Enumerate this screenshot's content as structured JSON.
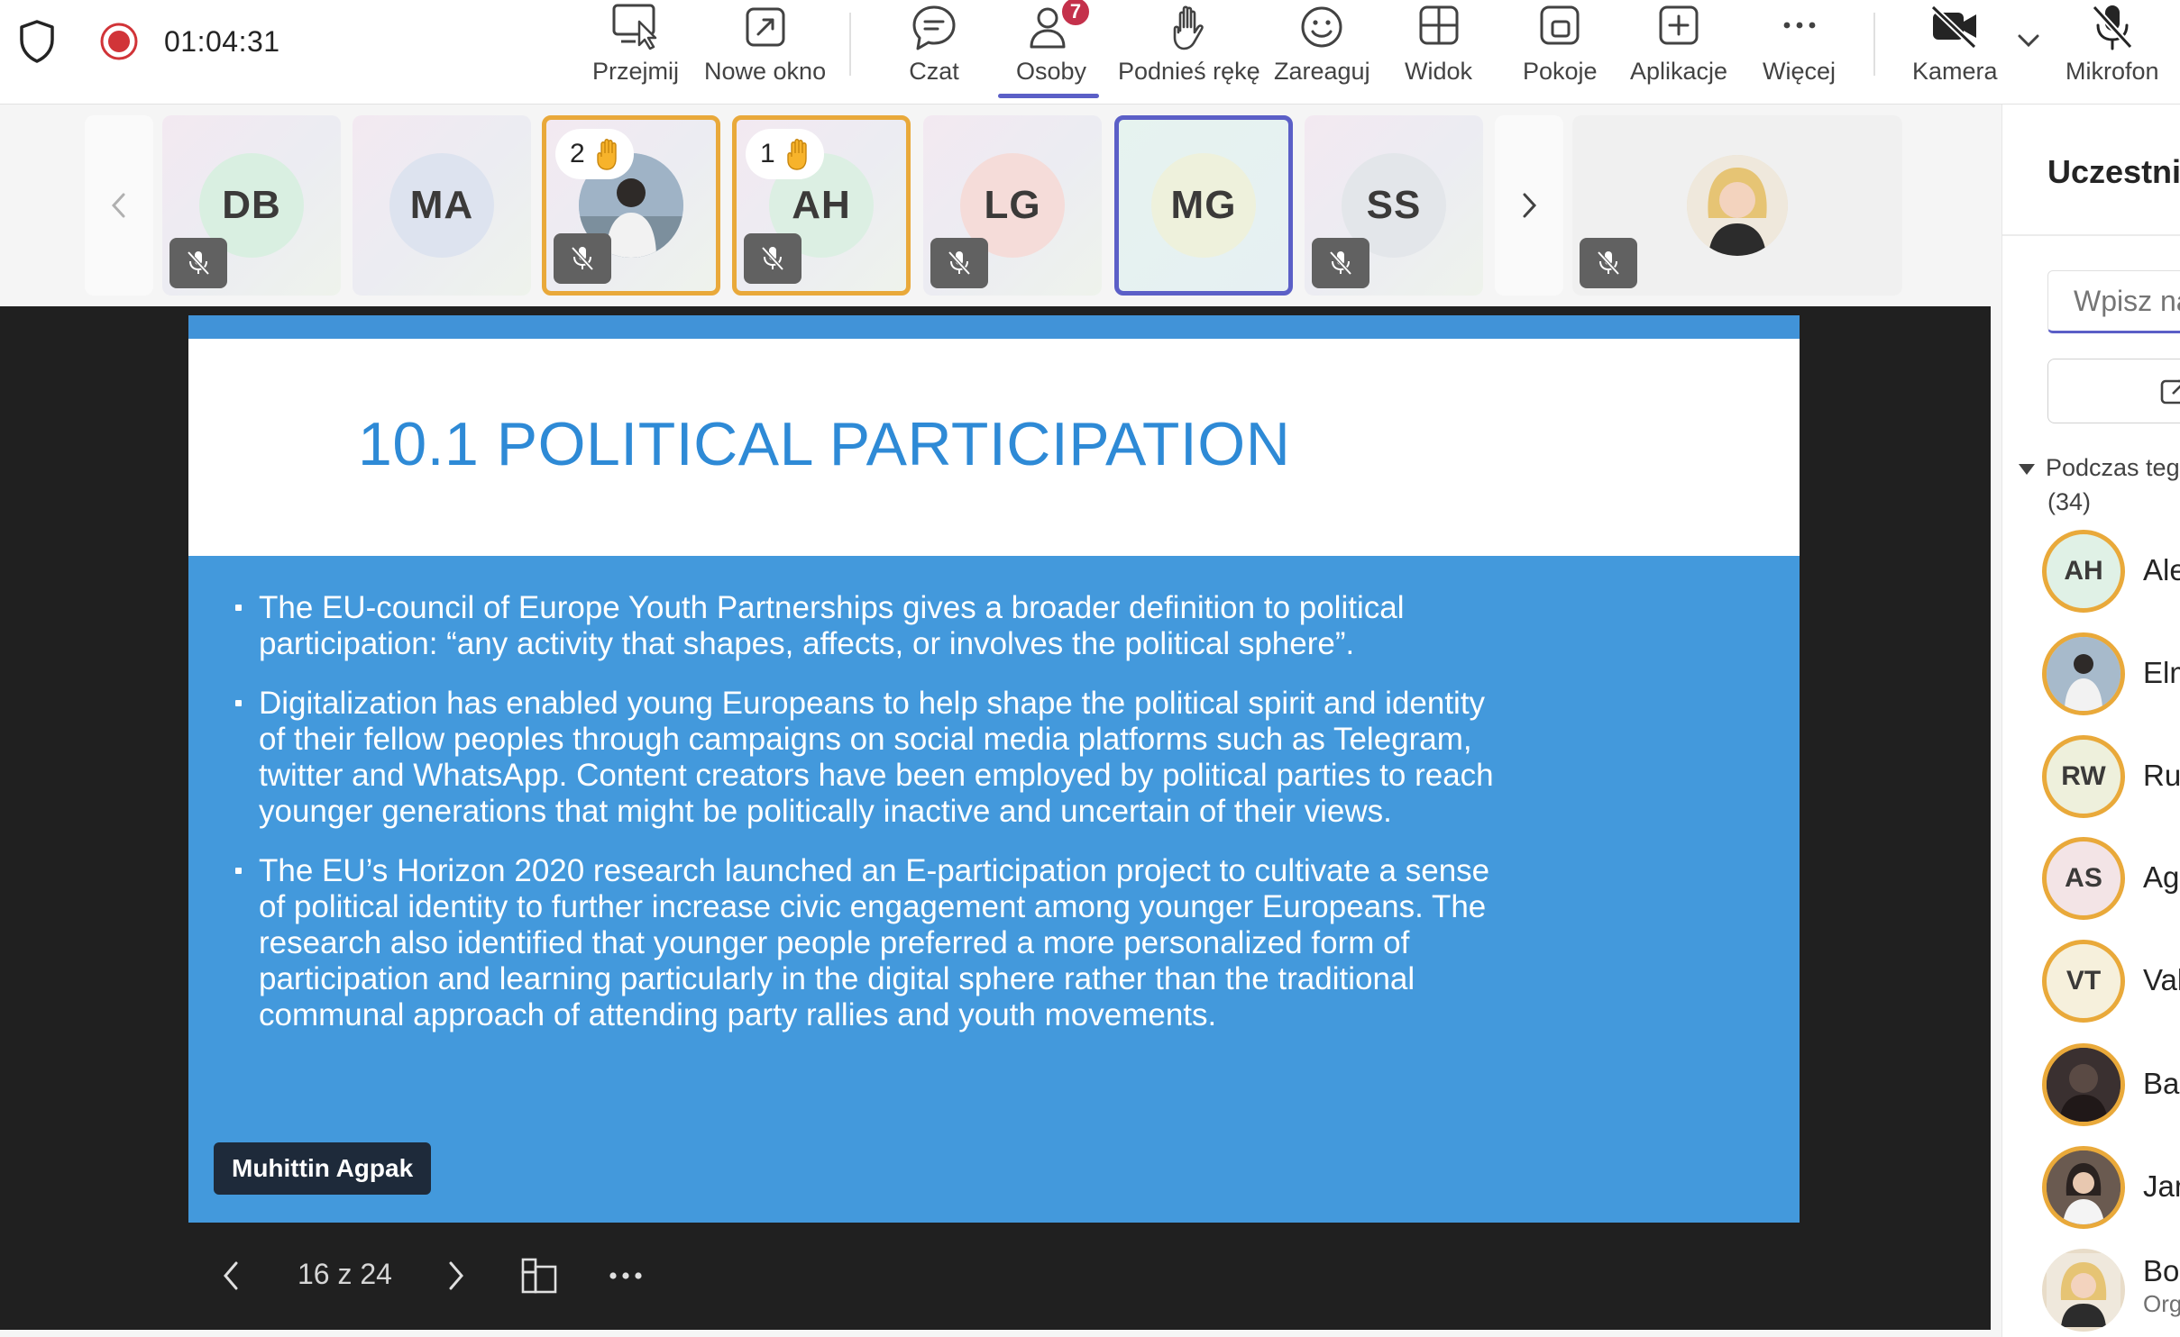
{
  "call": {
    "timer": "01:04:31"
  },
  "toolbar": {
    "buttons": [
      {
        "id": "takeover",
        "label": "Przejmij",
        "icon": "screen-pointer-icon"
      },
      {
        "id": "new-window",
        "label": "Nowe okno",
        "icon": "popout-icon"
      },
      {
        "id": "chat",
        "label": "Czat",
        "icon": "chat-icon"
      },
      {
        "id": "people",
        "label": "Osoby",
        "icon": "people-icon",
        "badge": "7",
        "active": true
      },
      {
        "id": "raise-hand",
        "label": "Podnieś rękę",
        "icon": "hand-icon"
      },
      {
        "id": "react",
        "label": "Zareaguj",
        "icon": "smiley-icon"
      },
      {
        "id": "view",
        "label": "Widok",
        "icon": "grid-icon"
      },
      {
        "id": "rooms",
        "label": "Pokoje",
        "icon": "rooms-icon"
      },
      {
        "id": "apps",
        "label": "Aplikacje",
        "icon": "plus-square-icon"
      },
      {
        "id": "more",
        "label": "Więcej",
        "icon": "ellipsis-icon"
      },
      {
        "id": "camera",
        "label": "Kamera",
        "icon": "camera-off-icon"
      },
      {
        "id": "mic",
        "label": "Mikrofon",
        "icon": "mic-off-icon"
      }
    ]
  },
  "strip": {
    "tiles": [
      {
        "initials": "DB",
        "avatar_color": "#d9efe1",
        "muted": true
      },
      {
        "initials": "MA",
        "avatar_color": "#dde3ef",
        "muted": false
      },
      {
        "initials": "",
        "photo": true,
        "hand_count": "2",
        "muted": true
      },
      {
        "initials": "AH",
        "avatar_color": "#dcefe3",
        "hand_count": "1",
        "muted": true
      },
      {
        "initials": "LG",
        "avatar_color": "#f5dcd9",
        "muted": true
      },
      {
        "initials": "MG",
        "avatar_color": "#eef1dc",
        "speaking": true,
        "muted": false
      },
      {
        "initials": "SS",
        "avatar_color": "#e3e6ea",
        "muted": true
      }
    ]
  },
  "slide": {
    "title": "10.1 POLITICAL PARTICIPATION",
    "bullets": [
      "The EU-council of Europe Youth Partnerships gives a broader definition to political participation: “any activity that shapes, affects, or involves the political sphere”.",
      "Digitalization has enabled young Europeans to help shape the political spirit and identity of their fellow peoples through campaigns on social media platforms such as Telegram, twitter and WhatsApp. Content creators have been employed by political parties to reach younger generations that might be politically inactive and uncertain of their views.",
      "The EU’s Horizon 2020 research launched an E-participation project to cultivate a sense of political identity to further increase civic engagement among younger Europeans. The research also identified that younger people preferred a more personalized form of participation and learning particularly in the digital sphere rather than the traditional communal approach of attending party rallies and youth movements."
    ],
    "presenter": "Muhittin Agpak",
    "page_counter": "16 z 24"
  },
  "panel": {
    "title": "Uczestni",
    "search_placeholder": "Wpisz na",
    "section_label": "Podczas teg",
    "section_count": "(34)",
    "people": [
      {
        "initials": "AH",
        "name": "Alel",
        "avatar_color": "#e0f1e6"
      },
      {
        "initials": "",
        "name": "Elm",
        "photo": true,
        "avatar_color": "#cfdbe8"
      },
      {
        "initials": "RW",
        "name": "Ruc",
        "avatar_color": "#eef0dc"
      },
      {
        "initials": "AS",
        "name": "Agr",
        "avatar_color": "#f3e4e6"
      },
      {
        "initials": "VT",
        "name": "Vale",
        "avatar_color": "#f6f0dc"
      },
      {
        "initials": "",
        "name": "Bau",
        "photo": true,
        "avatar_color": "#3a3030"
      },
      {
        "initials": "",
        "name": "Jam",
        "photo": true,
        "avatar_color": "#5a4a40"
      },
      {
        "initials": "",
        "name": "Boż",
        "sub": "Orga",
        "photo": true,
        "avatar_color": "#e8dcc8",
        "no_ring": true
      }
    ]
  },
  "colors": {
    "accent": "#5b5fc7",
    "hand_ring": "#e9a93a",
    "slide_blue": "#4399dc",
    "title_blue": "#2e8ad6",
    "record_red": "#d13438"
  }
}
